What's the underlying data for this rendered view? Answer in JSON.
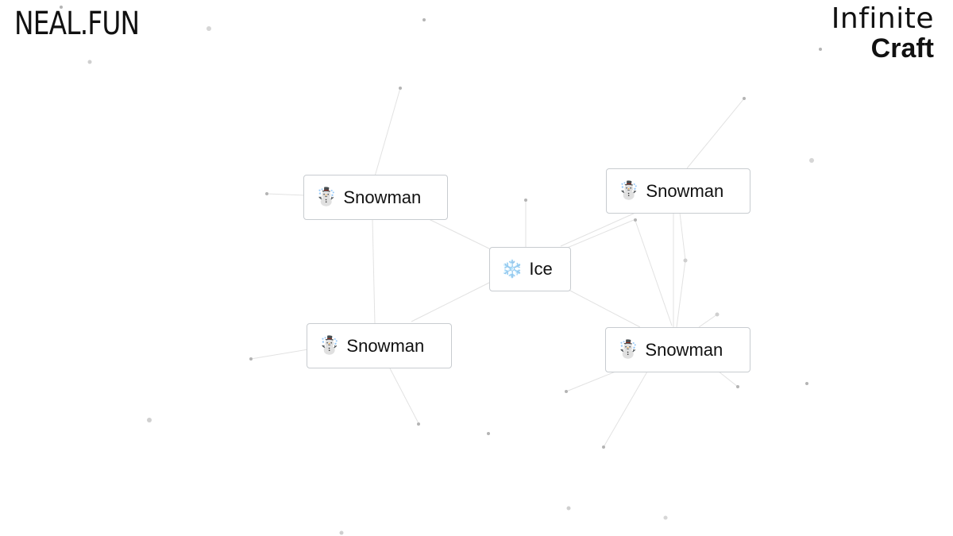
{
  "header": {
    "logo_text": "NEAL.FUN",
    "brand_line1": "Infinite",
    "brand_line2": "Craft"
  },
  "elements": [
    {
      "emoji": "☃️",
      "label": "Snowman",
      "icon": "snowman-icon"
    },
    {
      "emoji": "☃️",
      "label": "Snowman",
      "icon": "snowman-icon"
    },
    {
      "emoji": "❄️",
      "label": "Ice",
      "icon": "snowflake-icon"
    },
    {
      "emoji": "☃️",
      "label": "Snowman",
      "icon": "snowman-icon"
    },
    {
      "emoji": "☃️",
      "label": "Snowman",
      "icon": "snowman-icon"
    }
  ],
  "colors": {
    "background": "#ffffff",
    "card_border": "#c8ccd0",
    "particle": "#b0b0b0",
    "line": "#e3e3e3"
  }
}
